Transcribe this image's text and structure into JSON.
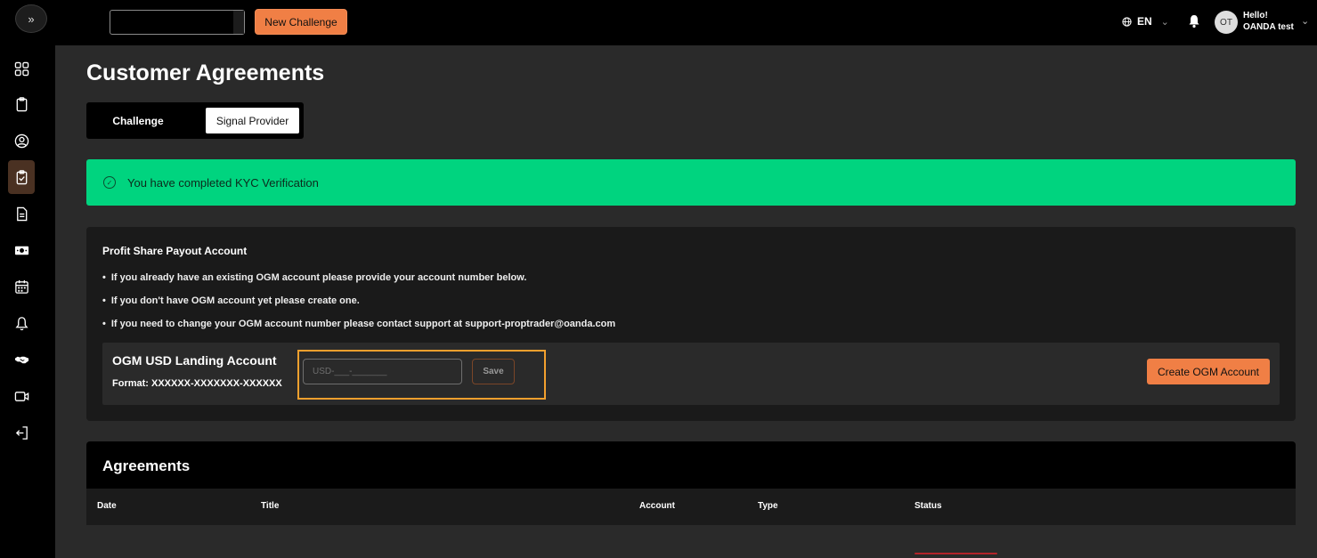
{
  "topbar": {
    "expand_icon": "»",
    "new_challenge_label": "New Challenge",
    "language": "EN",
    "avatar_initials": "OT",
    "greeting": "Hello!",
    "user_name": "OANDA test"
  },
  "sidebar": {
    "items": [
      {
        "icon": "dashboard-grid-icon"
      },
      {
        "icon": "clipboard-icon"
      },
      {
        "icon": "user-circle-icon"
      },
      {
        "icon": "clipboard-check-icon",
        "active": true
      },
      {
        "icon": "document-icon"
      },
      {
        "icon": "money-icon"
      },
      {
        "icon": "calendar-icon"
      },
      {
        "icon": "bell-outline-icon"
      },
      {
        "icon": "handshake-icon"
      },
      {
        "icon": "video-icon"
      },
      {
        "icon": "logout-icon"
      }
    ]
  },
  "page": {
    "title": "Customer Agreements",
    "tabs": [
      {
        "label": "Challenge",
        "active": false
      },
      {
        "label": "Signal Provider",
        "active": true
      }
    ]
  },
  "kyc_banner": {
    "text": "You have completed KYC Verification",
    "color": "#00d47f"
  },
  "payout": {
    "title": "Profit Share Payout Account",
    "bullets": [
      "If you already have an existing OGM account please provide your account number below.",
      "If you don't have OGM account yet please create one.",
      "If you need to change your OGM account number please contact support at support-proptrader@oanda.com"
    ],
    "landing_title": "OGM USD Landing Account",
    "landing_format": "Format: XXXXXX-XXXXXXX-XXXXXX",
    "input_placeholder": "USD-___-_______",
    "save_label": "Save",
    "create_label": "Create OGM Account"
  },
  "agreements": {
    "title": "Agreements",
    "columns": [
      "Date",
      "Title",
      "Account",
      "Type",
      "Status"
    ]
  },
  "colors": {
    "accent": "#f07f45",
    "highlight": "#f3a02e"
  }
}
